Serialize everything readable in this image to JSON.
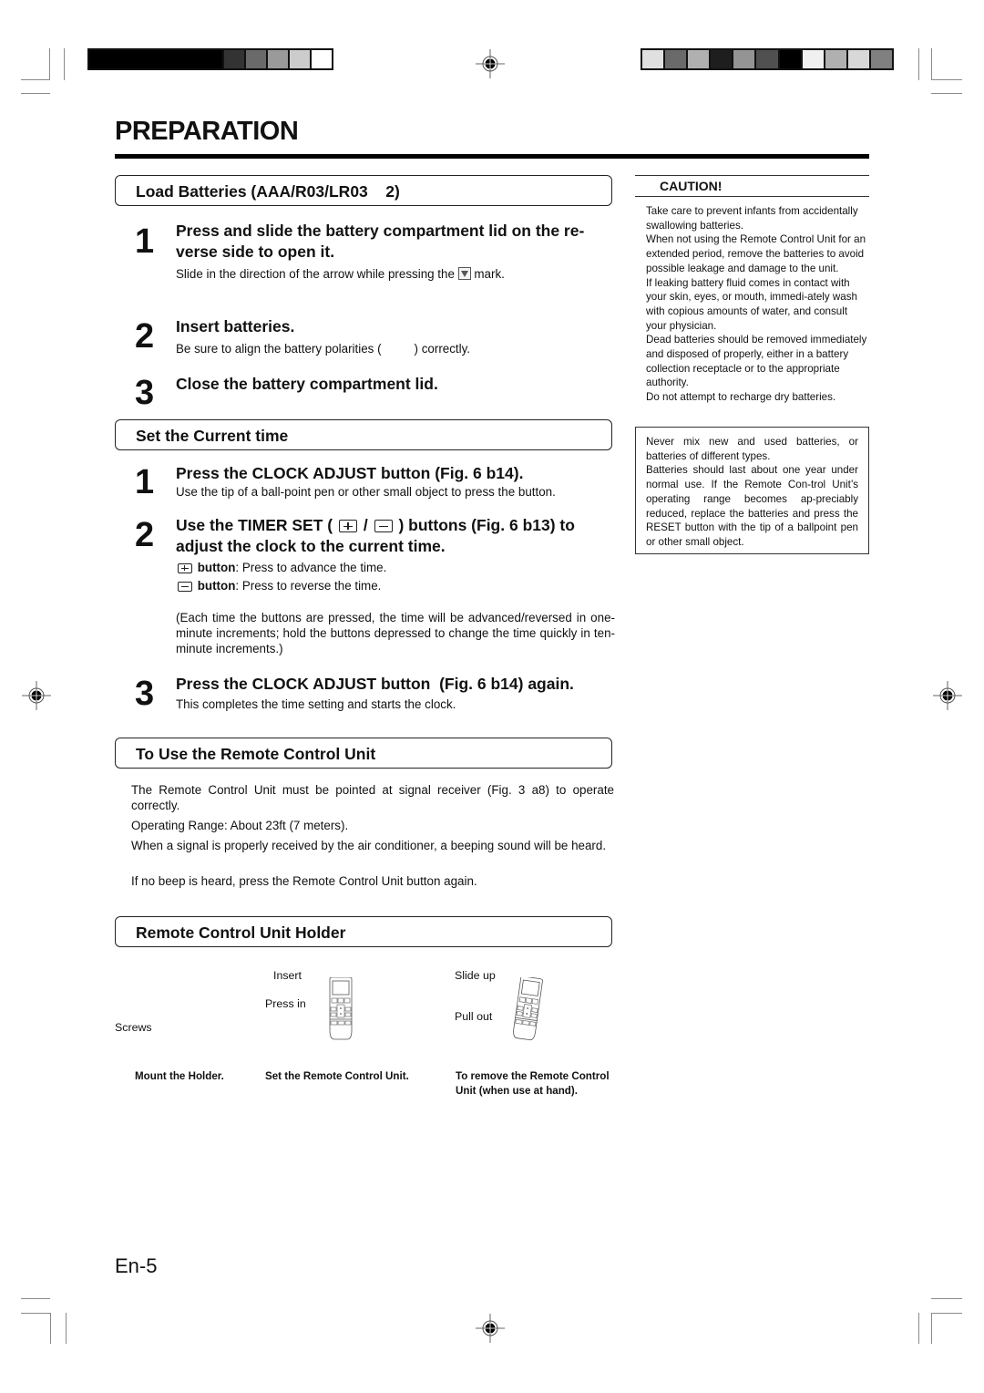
{
  "page": {
    "title": "PREPARATION",
    "page_number": "En-5"
  },
  "colors": {
    "text": "#111111",
    "rule": "#000000",
    "crop_mark": "#8a8a8a",
    "left_bar_swatches": [
      "#333333",
      "#6a6a6a",
      "#9a9a9a",
      "#cccccc",
      "#ffffff"
    ],
    "right_bar_swatches": [
      "#e0e0e0",
      "#6a6a6a",
      "#b0b0b0",
      "#1e1e1e",
      "#949494",
      "#505050",
      "#000000",
      "#f0f0f0",
      "#b0b0b0",
      "#d8d8d8",
      "#808080"
    ]
  },
  "load_batteries": {
    "heading": "Load Batteries (AAA/R03/LR03    2)",
    "steps": [
      {
        "number": "1",
        "title": "Press and slide the battery compartment lid on the re-verse side to open it.",
        "title_line1": "Press and slide the battery compartment lid on the re-",
        "title_line2": "verse side to open it.",
        "desc_before": "Slide in the direction of the arrow while pressing the",
        "desc_icon": "down-triangle-mark-icon",
        "desc_after": "mark."
      },
      {
        "number": "2",
        "title": "Insert batteries.",
        "desc_before": "Be sure to align the battery polarities (",
        "desc_after": ") correctly."
      },
      {
        "number": "3",
        "title": "Close the battery compartment lid."
      }
    ]
  },
  "set_time": {
    "heading": "Set the Current time",
    "steps": [
      {
        "number": "1",
        "title": "Press the CLOCK ADJUST button (Fig. 6 b14).",
        "desc": "Use the tip of a ball-point pen or other small object to press the button."
      },
      {
        "number": "2",
        "title_part1": "Use the TIMER SET (",
        "title_sep": "/",
        "title_part2": ") buttons (Fig. 6 b13) to",
        "title_line2": "adjust the clock to the current time.",
        "plus_label": "button",
        "plus_desc": ": Press to advance the time.",
        "minus_label": "button",
        "minus_desc": ": Press to reverse the time.",
        "note": "(Each time the buttons are pressed, the time will be advanced/reversed in one-minute increments; hold the buttons depressed to change the time quickly in ten-minute increments.)"
      },
      {
        "number": "3",
        "title": "Press the CLOCK ADJUST button  (Fig. 6 b14) again.",
        "desc": "This completes the time setting and starts the clock."
      }
    ]
  },
  "remote_use": {
    "heading": "To Use the Remote Control Unit",
    "paragraphs": [
      "The Remote Control Unit must be pointed at signal receiver (Fig. 3 a8) to operate correctly.",
      "Operating Range: About 23ft (7 meters).",
      "When a signal is properly received by the air conditioner, a beeping sound will be heard.",
      "If no beep is heard, press the Remote Control Unit button again."
    ]
  },
  "holder": {
    "heading": "Remote Control Unit Holder",
    "labels": {
      "screws": "Screws",
      "insert": "Insert",
      "press_in": "Press in",
      "slide_up": "Slide up",
      "pull_out": "Pull out"
    },
    "captions": [
      "Mount the Holder.",
      "Set the Remote Control Unit.",
      "To remove the Remote Control Unit (when use at hand)."
    ]
  },
  "caution": {
    "title": "CAUTION!",
    "paragraphs": [
      "Take care to prevent infants from accidentally swallowing batteries.",
      "When not using the Remote Control Unit for an extended period, remove the batteries to avoid possible leakage and damage to the unit.",
      "If leaking battery fluid comes in contact with your skin, eyes, or mouth, immedi-ately wash with copious amounts of water, and consult your physician.",
      "Dead batteries should be removed immediately and disposed of properly, either in a battery collection receptacle or to the appropriate authority.",
      "Do not attempt to recharge dry batteries."
    ],
    "box_paragraphs": [
      "Never mix new and used batteries, or batteries of different types.",
      "Batteries should last about one year under normal use. If the Remote Con-trol Unit’s operating range becomes ap-preciably reduced, replace the batteries and press the RESET button with the tip of a ballpoint pen or other small object."
    ]
  }
}
